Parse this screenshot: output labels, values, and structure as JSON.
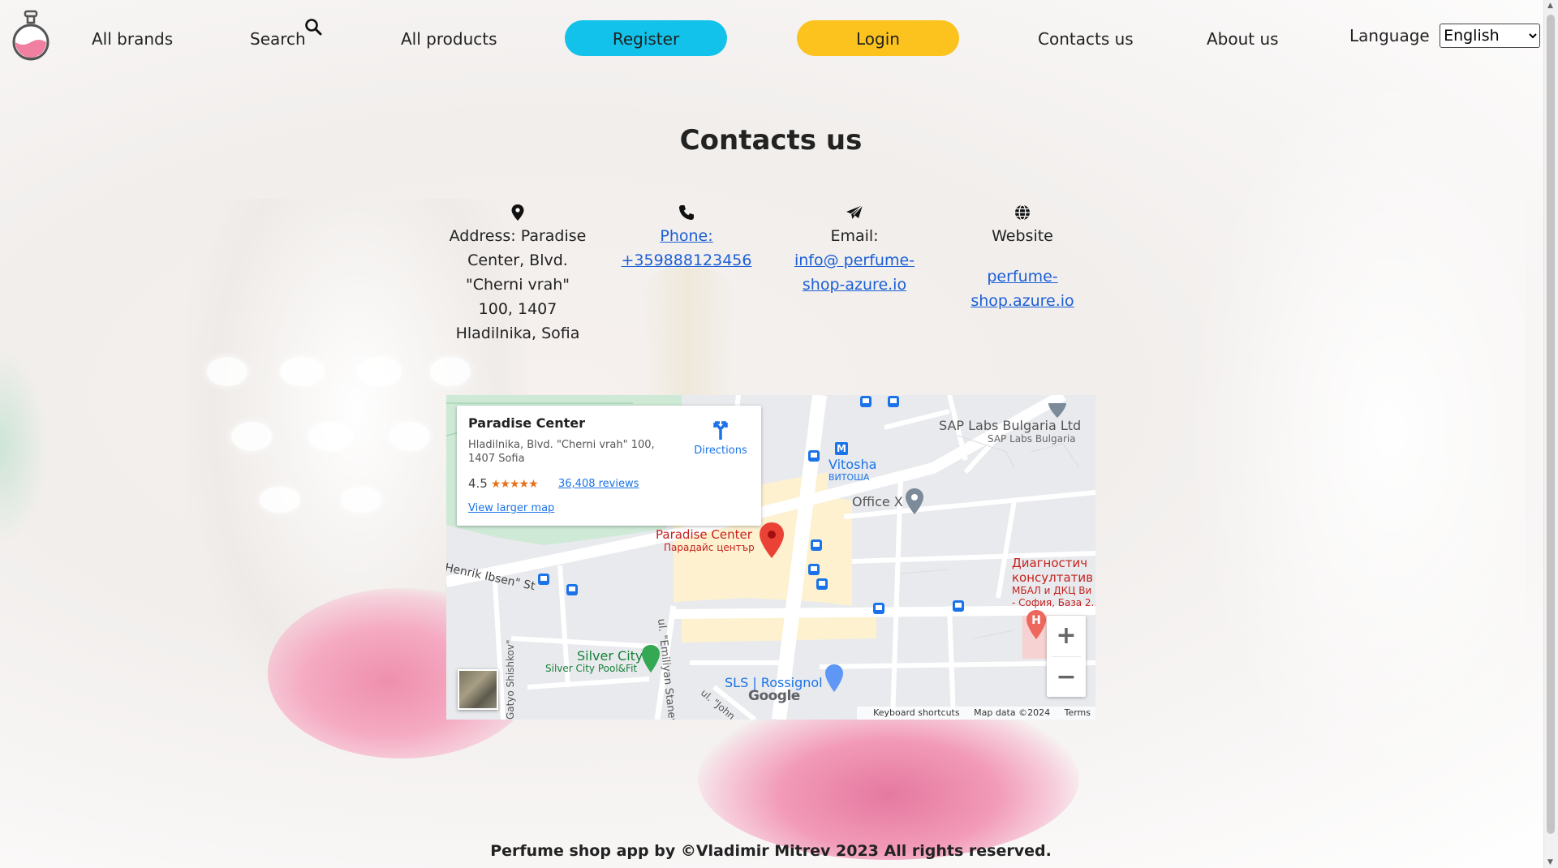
{
  "nav": {
    "all_brands": "All brands",
    "search": "Search",
    "all_products": "All products",
    "register": "Register",
    "login": "Login",
    "contacts": "Contacts us",
    "about": "About us",
    "language_label": "Language",
    "language_value": "English"
  },
  "page": {
    "title": "Contacts us"
  },
  "contacts": {
    "address": "Address: Paradise Center, Blvd. \"Cherni vrah\" 100, 1407 Hladilnika, Sofia",
    "phone_label": "Phone:",
    "phone_number": "+359888123456",
    "email_label": "Email:",
    "email_value": "info@ perfume-shop-azure.io",
    "website_label": "Website",
    "website_value": "perfume-shop.azure.io"
  },
  "map": {
    "card_title": "Paradise Center",
    "card_address": "Hladilnika, Blvd. \"Cherni vrah\" 100, 1407 Sofia",
    "rating": "4.5",
    "rating_stars": 4.5,
    "stars_text": "★★★★★",
    "reviews": "36,408 reviews",
    "view_larger": "View larger map",
    "directions": "Directions",
    "zoom_in": "+",
    "zoom_out": "−",
    "keyboard": "Keyboard shortcuts",
    "map_data": "Map data ©2024",
    "terms": "Terms",
    "google": "Google",
    "labels": {
      "paradise_en": "Paradise Center",
      "paradise_bg": "Парадайс център",
      "sap": "SAP Labs Bulgaria Ltd",
      "sap_sub": "SAP Labs Bulgaria",
      "vitosha": "Vitosha",
      "vitosha_bg": "ВИТОША",
      "office": "Office X",
      "diag1": "Диагностич",
      "diag2": "консултатив",
      "diag3": "МБАЛ и ДКЦ Ви",
      "diag4": "- София, База 2..",
      "ibsen": "Henrik Ibsen\" St",
      "silver": "Silver City",
      "silver_sub": "Silver City Pool&Fit",
      "sls": "SLS | Rossignol",
      "emiliyan": "ul. \"Emiliyan Stanev",
      "shishkov": "Gatyo Shishkov\"",
      "john": "ul. \"John",
      "metro": "M",
      "hospital": "H"
    }
  },
  "footer": {
    "text": "Perfume shop app by ©Vladimir Mitrev 2023 All rights reserved."
  },
  "colors": {
    "register": "#12c2ea",
    "login": "#fcc31e",
    "link": "#1a5fd6",
    "pin": "#ea4335"
  }
}
